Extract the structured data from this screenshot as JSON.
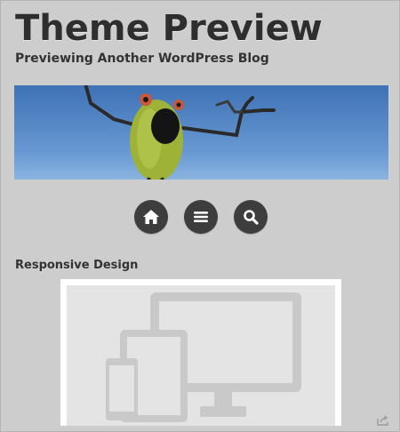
{
  "header": {
    "title": "Theme Preview",
    "tagline": "Previewing Another WordPress Blog"
  },
  "nav": {
    "items": [
      {
        "icon": "home-icon"
      },
      {
        "icon": "menu-icon"
      },
      {
        "icon": "search-icon"
      }
    ]
  },
  "post": {
    "title": "Responsive Design",
    "image_icon": "devices-icon"
  },
  "footer": {
    "icon": "share-icon"
  },
  "colors": {
    "background": "#cdcdcd",
    "title": "#2e2e2e",
    "nav_button": "#3d3d3d",
    "sky": "#5b8fd0",
    "frog": "#9db236"
  }
}
